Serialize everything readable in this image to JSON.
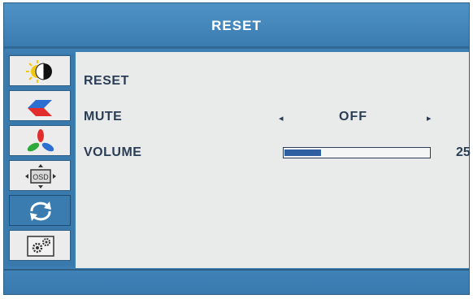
{
  "header": {
    "title": "RESET"
  },
  "sidebar": {
    "tabs": [
      {
        "icon": "brightness-contrast-icon",
        "active": false
      },
      {
        "icon": "image-setup-icon",
        "active": false
      },
      {
        "icon": "color-icon",
        "active": false
      },
      {
        "icon": "osd-setup-icon",
        "active": false
      },
      {
        "icon": "reset-icon",
        "active": true
      },
      {
        "icon": "settings-gears-icon",
        "active": false
      }
    ]
  },
  "menu": {
    "reset_label": "RESET",
    "mute": {
      "label": "MUTE",
      "value": "OFF",
      "left_arrow": "◂",
      "right_arrow": "▸"
    },
    "volume": {
      "label": "VOLUME",
      "value": "25",
      "level": 0.25
    }
  },
  "colors": {
    "accent": "#3e7fb3",
    "content_bg": "#e9ebea",
    "text": "#2a3d55"
  }
}
